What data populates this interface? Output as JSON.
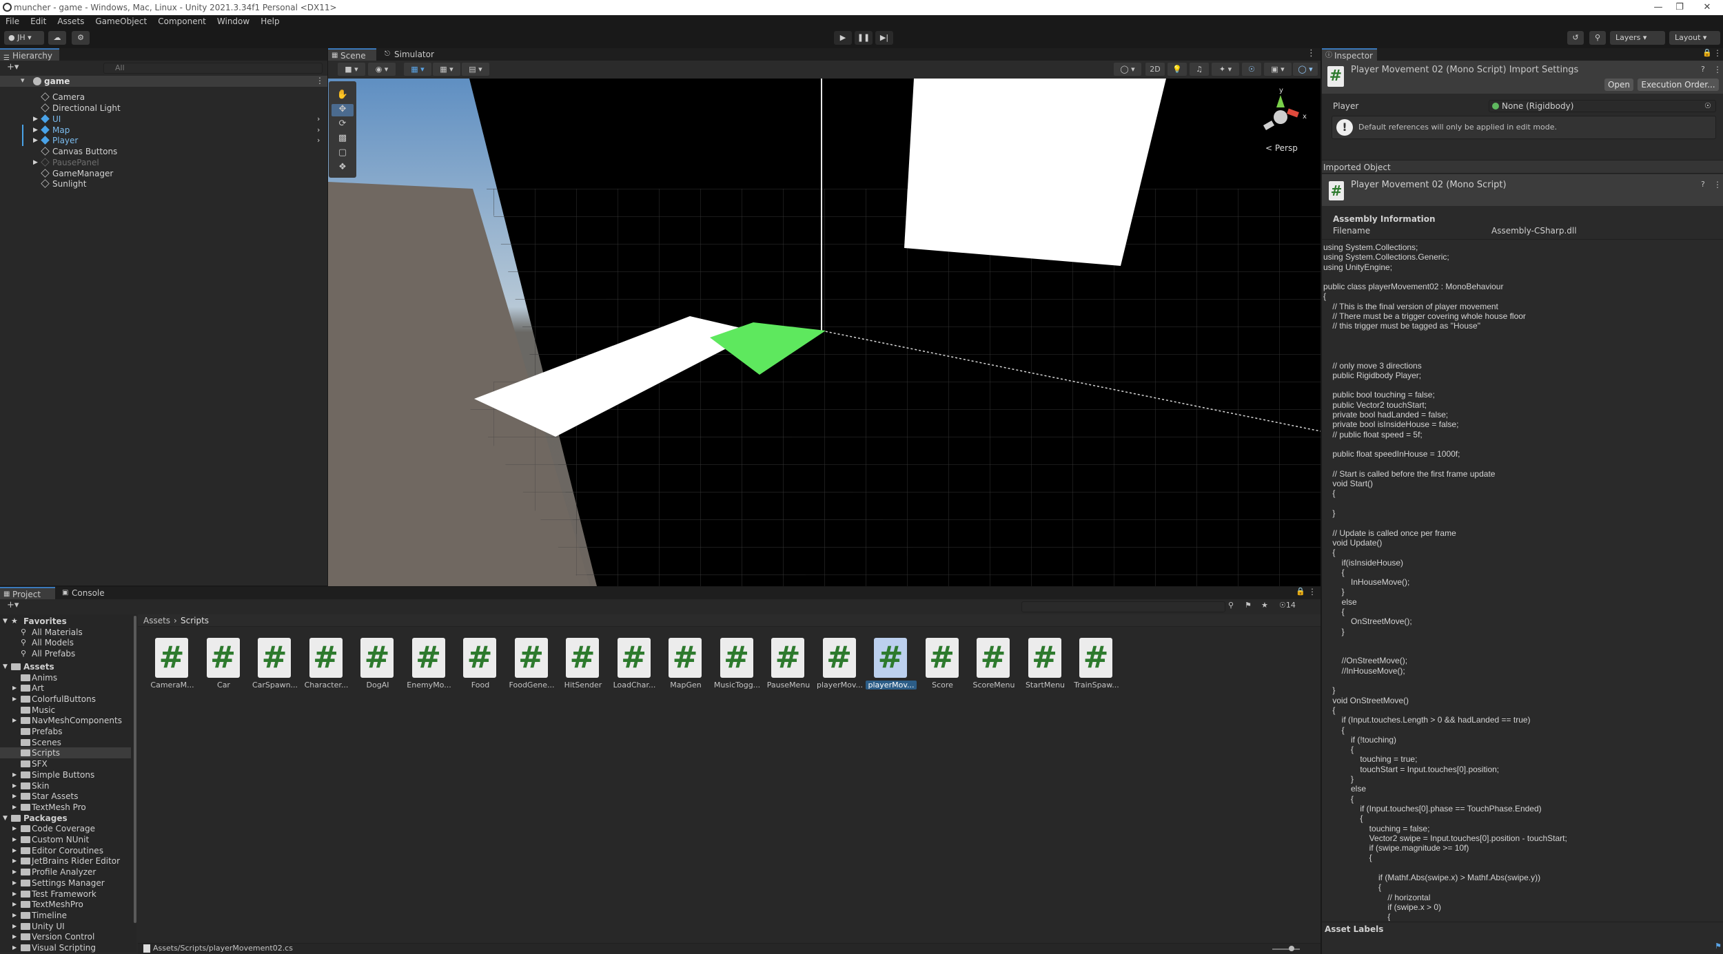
{
  "window": {
    "title": "muncher - game - Windows, Mac, Linux - Unity 2021.3.34f1 Personal <DX11>"
  },
  "menu": [
    "File",
    "Edit",
    "Assets",
    "GameObject",
    "Component",
    "Window",
    "Help"
  ],
  "toolbar": {
    "account": "JH",
    "layers": "Layers",
    "layout": "Layout"
  },
  "hierarchy": {
    "tab": "Hierarchy",
    "search_placeholder": "All",
    "scene": "game",
    "items": [
      {
        "label": "Camera",
        "kind": "object"
      },
      {
        "label": "Directional Light",
        "kind": "object"
      },
      {
        "label": "UI",
        "kind": "prefab"
      },
      {
        "label": "Map",
        "kind": "prefab"
      },
      {
        "label": "Player",
        "kind": "prefab"
      },
      {
        "label": "Canvas Buttons",
        "kind": "object"
      },
      {
        "label": "PausePanel",
        "kind": "disabled"
      },
      {
        "label": "GameManager",
        "kind": "object"
      },
      {
        "label": "Sunlight",
        "kind": "object"
      }
    ]
  },
  "scene_view": {
    "tabs": [
      "Scene",
      "Simulator"
    ],
    "mode_2d": "2D",
    "gizmo_label": "< Persp",
    "gizmo_axes": [
      "y",
      "x"
    ]
  },
  "project": {
    "tabs": [
      "Project",
      "Console"
    ],
    "breadcrumb": [
      "Assets",
      "Scripts"
    ],
    "badge": "14",
    "favorites_label": "Favorites",
    "favorites": [
      "All Materials",
      "All Models",
      "All Prefabs"
    ],
    "assets_label": "Assets",
    "assets_folders": [
      "Anims",
      "Art",
      "ColorfulButtons",
      "Music",
      "NavMeshComponents",
      "Prefabs",
      "Scenes",
      "Scripts",
      "SFX",
      "Simple Buttons",
      "Skin",
      "Star Assets",
      "TextMesh Pro"
    ],
    "packages_label": "Packages",
    "packages": [
      "Code Coverage",
      "Custom NUnit",
      "Editor Coroutines",
      "JetBrains Rider Editor",
      "Profile Analyzer",
      "Settings Manager",
      "Test Framework",
      "TextMeshPro",
      "Timeline",
      "Unity UI",
      "Version Control",
      "Visual Scripting"
    ],
    "scripts": [
      "CameraM...",
      "Car",
      "CarSpawn...",
      "Character...",
      "DogAI",
      "EnemyMo...",
      "Food",
      "FoodGene...",
      "HitSender",
      "LoadChar...",
      "MapGen",
      "MusicTogg...",
      "PauseMenu",
      "playerMov...",
      "playerMov...",
      "Score",
      "ScoreMenu",
      "StartMenu",
      "TrainSpaw..."
    ],
    "selected_index": 14,
    "status_path": "Assets/Scripts/playerMovement02.cs"
  },
  "inspector": {
    "tab": "Inspector",
    "title": "Player Movement 02 (Mono Script) Import Settings",
    "open_button": "Open",
    "exec_button": "Execution Order...",
    "player_label": "Player",
    "player_value": "None (Rigidbody)",
    "help_text": "Default references will only be applied in edit mode.",
    "imported_object": "Imported Object",
    "script_title": "Player Movement 02 (Mono Script)",
    "assembly_header": "Assembly Information",
    "filename_label": "Filename",
    "filename_value": "Assembly-CSharp.dll",
    "asset_labels": "Asset Labels",
    "code": "using System.Collections;\nusing System.Collections.Generic;\nusing UnityEngine;\n\npublic class playerMovement02 : MonoBehaviour\n{\n    // This is the final version of player movement\n    // There must be a trigger covering whole house floor\n    // this trigger must be tagged as \"House\"\n\n\n\n    // only move 3 directions\n    public Rigidbody Player;\n\n    public bool touching = false;\n    public Vector2 touchStart;\n    private bool hadLanded = false;\n    private bool isInsideHouse = false;\n    // public float speed = 5f;\n\n    public float speedInHouse = 1000f;\n\n    // Start is called before the first frame update\n    void Start()\n    {\n\n    }\n\n    // Update is called once per frame\n    void Update()\n    {\n        if(isInsideHouse)\n        {\n            InHouseMove();\n        }\n        else\n        {\n            OnStreetMove();\n        }\n\n\n        //OnStreetMove();\n        //InHouseMove();\n\n    }\n    void OnStreetMove()\n    {\n        if (Input.touches.Length > 0 && hadLanded == true)\n        {\n            if (!touching)\n            {\n                touching = true;\n                touchStart = Input.touches[0].position;\n            }\n            else\n            {\n                if (Input.touches[0].phase == TouchPhase.Ended)\n                {\n                    touching = false;\n                    Vector2 swipe = Input.touches[0].position - touchStart;\n                    if (swipe.magnitude >= 10f)\n                    {\n\n                        if (Mathf.Abs(swipe.x) > Mathf.Abs(swipe.y))\n                        {\n                            // horizontal\n                            if (swipe.x > 0)\n                            {"
  }
}
